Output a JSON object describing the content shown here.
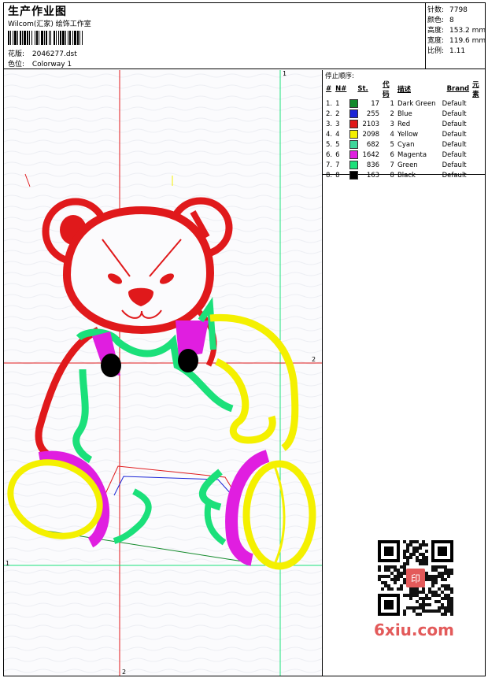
{
  "header": {
    "title": "生产作业图",
    "subtitle": "Wilcom(汇家) 绘饰工作室",
    "design_label": "花版:",
    "design_value": "2046277.dst",
    "colorway_label": "色位:",
    "colorway_value": "Colorway 1"
  },
  "stats": [
    {
      "label": "针数:",
      "value": "7798"
    },
    {
      "label": "颜色:",
      "value": "8"
    },
    {
      "label": "高度:",
      "value": "153.2 mm"
    },
    {
      "label": "宽度:",
      "value": "119.6 mm"
    },
    {
      "label": "比例:",
      "value": "1.11"
    }
  ],
  "sequence": {
    "title": "停止顺序:",
    "headers": [
      "#",
      "N#",
      "St.",
      "代码",
      "描述",
      "Brand",
      "元素"
    ],
    "rows": [
      {
        "idx": "1.",
        "n": "1",
        "color": "#128a2a",
        "st": "17",
        "code": "1",
        "desc": "Dark Green",
        "brand": "Default"
      },
      {
        "idx": "2.",
        "n": "2",
        "color": "#1a25d6",
        "st": "255",
        "code": "2",
        "desc": "Blue",
        "brand": "Default"
      },
      {
        "idx": "3.",
        "n": "3",
        "color": "#e0191b",
        "st": "2103",
        "code": "3",
        "desc": "Red",
        "brand": "Default"
      },
      {
        "idx": "4.",
        "n": "4",
        "color": "#f4f000",
        "st": "2098",
        "code": "4",
        "desc": "Yellow",
        "brand": "Default"
      },
      {
        "idx": "5.",
        "n": "5",
        "color": "#3ed69a",
        "st": "682",
        "code": "5",
        "desc": "Cyan",
        "brand": "Default"
      },
      {
        "idx": "6.",
        "n": "6",
        "color": "#e01ee0",
        "st": "1642",
        "code": "6",
        "desc": "Magenta",
        "brand": "Default"
      },
      {
        "idx": "7.",
        "n": "7",
        "color": "#1be07a",
        "st": "836",
        "code": "7",
        "desc": "Green",
        "brand": "Default"
      },
      {
        "idx": "8.",
        "n": "8",
        "color": "#000000",
        "st": "163",
        "code": "8",
        "desc": "Black",
        "brand": "Default"
      }
    ]
  },
  "guides": {
    "v_green_label": "1",
    "h_green_label": "1",
    "h_red_label": "2",
    "v_red_label": "2"
  },
  "watermark": {
    "brand": "6xiu.com",
    "seal": "印"
  },
  "colors": {
    "red": "#e0191b",
    "yellow": "#f4f000",
    "magenta": "#e01ee0",
    "green": "#1be07a",
    "black": "#000000"
  }
}
